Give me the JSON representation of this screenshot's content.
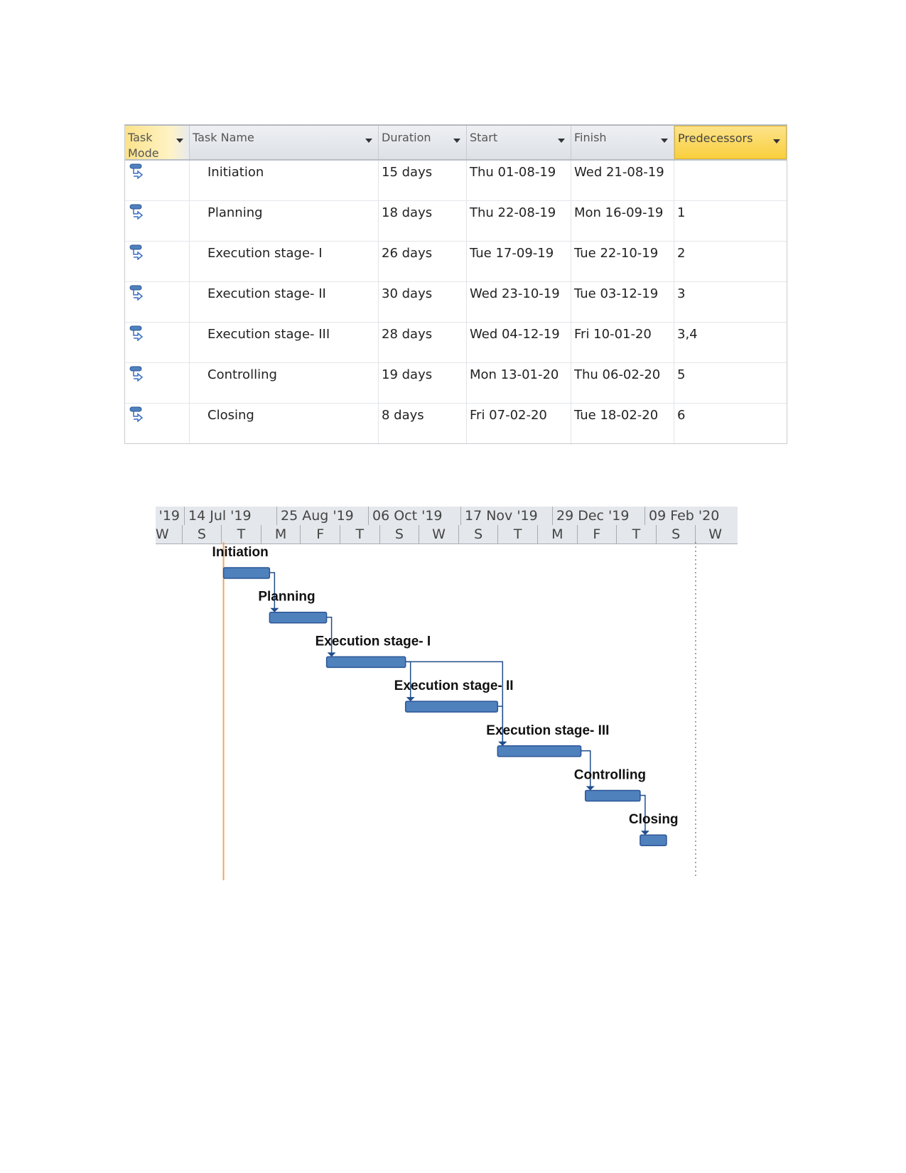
{
  "table": {
    "headers": {
      "task_mode": "Task Mode",
      "task_name": "Task Name",
      "duration": "Duration",
      "start": "Start",
      "finish": "Finish",
      "predecessors": "Predecessors"
    },
    "rows": [
      {
        "mode_icon": "auto-scheduled-task-icon",
        "name": "Initiation",
        "duration": "15 days",
        "start": "Thu 01-08-19",
        "finish": "Wed 21-08-19",
        "predecessors": ""
      },
      {
        "mode_icon": "auto-scheduled-task-icon",
        "name": "Planning",
        "duration": "18 days",
        "start": "Thu 22-08-19",
        "finish": "Mon 16-09-19",
        "predecessors": "1"
      },
      {
        "mode_icon": "auto-scheduled-task-icon",
        "name": "Execution stage- I",
        "duration": "26 days",
        "start": "Tue 17-09-19",
        "finish": "Tue 22-10-19",
        "predecessors": "2"
      },
      {
        "mode_icon": "auto-scheduled-task-icon",
        "name": "Execution stage- II",
        "duration": "30 days",
        "start": "Wed 23-10-19",
        "finish": "Tue 03-12-19",
        "predecessors": "3"
      },
      {
        "mode_icon": "auto-scheduled-task-icon",
        "name": "Execution stage- III",
        "duration": "28 days",
        "start": "Wed 04-12-19",
        "finish": "Fri 10-01-20",
        "predecessors": "3,4"
      },
      {
        "mode_icon": "auto-scheduled-task-icon",
        "name": "Controlling",
        "duration": "19 days",
        "start": "Mon 13-01-20",
        "finish": "Thu 06-02-20",
        "predecessors": "5"
      },
      {
        "mode_icon": "auto-scheduled-task-icon",
        "name": "Closing",
        "duration": "8 days",
        "start": "Fri 07-02-20",
        "finish": "Tue 18-02-20",
        "predecessors": "6"
      }
    ]
  },
  "gantt": {
    "top_tier": [
      "'19",
      "14 Jul '19",
      "25 Aug '19",
      "06 Oct '19",
      "17 Nov '19",
      "29 Dec '19",
      "09 Feb '20"
    ],
    "bottom_tier": [
      "W",
      "S",
      "T",
      "M",
      "F",
      "T",
      "S",
      "W",
      "S",
      "T",
      "M",
      "F",
      "T",
      "S",
      "W"
    ],
    "colors": {
      "bar": "#4f81bd",
      "bar_border": "#2c5597",
      "link": "#1f4e8c",
      "current_date_line": "#f4a460",
      "project_finish_line": "#888888"
    }
  }
}
